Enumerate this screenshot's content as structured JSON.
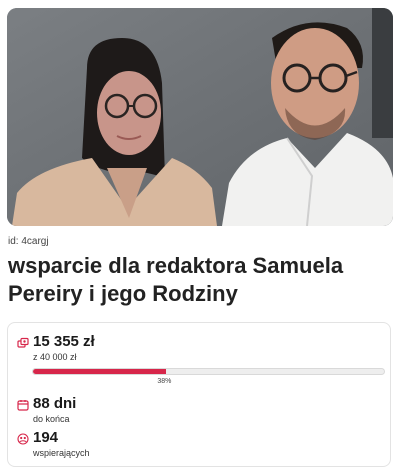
{
  "fundraiser": {
    "id_label": "id: 4cargj",
    "title": "wsparcie dla redaktora Samuela Pereiry i jego Rodziny",
    "photo_alt": "photo"
  },
  "stats": {
    "raised": "15 355 zł",
    "goal": "z 40 000 zł",
    "progress_percent": 38,
    "progress_label": "38%",
    "days_left": "88 dni",
    "days_left_sub": "do końca",
    "supporters": "194",
    "supporters_sub": "wspierających"
  },
  "colors": {
    "accent": "#d7264a",
    "text": "#222222"
  },
  "icons": {
    "raised": "coins-icon",
    "days": "calendar-icon",
    "supporters": "people-icon"
  }
}
